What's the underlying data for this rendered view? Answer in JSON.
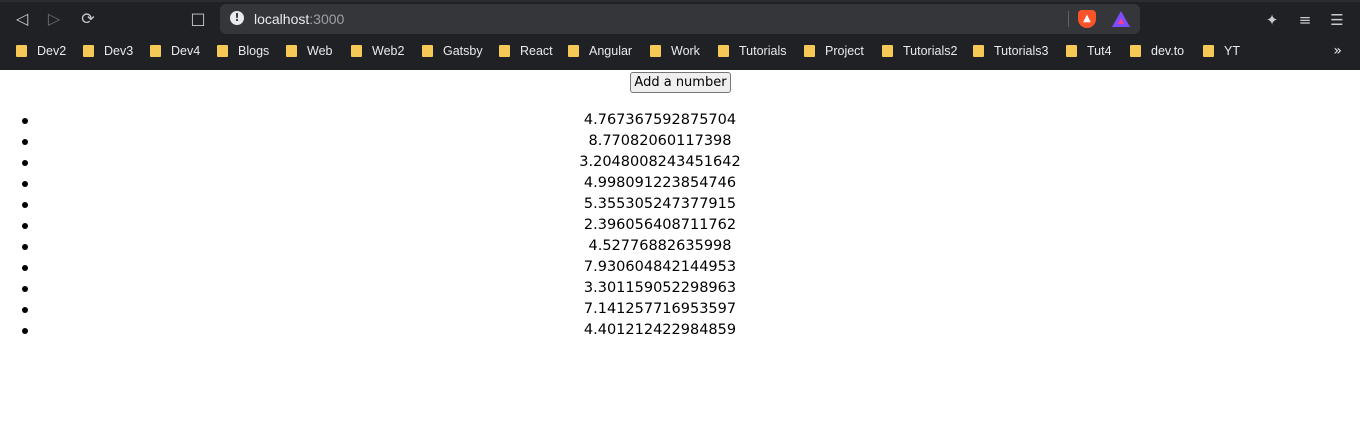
{
  "browser": {
    "url_host": "localhost",
    "url_port": ":3000",
    "bookmarks": [
      "Dev2",
      "Dev3",
      "Dev4",
      "Blogs",
      "Web",
      "Web2",
      "Gatsby",
      "React",
      "Angular",
      "Work",
      "Tutorials",
      "Project",
      "Tutorials2",
      "Tutorials3",
      "Tut4",
      "dev.to",
      "YT"
    ],
    "more_label": "»",
    "icons": {
      "back": "back-arrow-icon",
      "forward": "forward-arrow-icon",
      "reload": "reload-icon",
      "bookmark": "bookmark-icon",
      "info": "info-icon",
      "brave": "brave-shields-icon",
      "rewards": "brave-rewards-icon",
      "extensions": "extensions-icon",
      "playlist": "playlist-icon",
      "menu": "menu-icon"
    }
  },
  "page": {
    "button_label": "Add a number",
    "numbers": [
      "4.767367592875704",
      "8.77082060117398",
      "3.2048008243451642",
      "4.998091223854746",
      "5.355305247377915",
      "2.396056408711762",
      "4.52776882635998",
      "7.930604842144953",
      "3.301159052298963",
      "7.141257716953597",
      "4.401212422984859"
    ]
  }
}
